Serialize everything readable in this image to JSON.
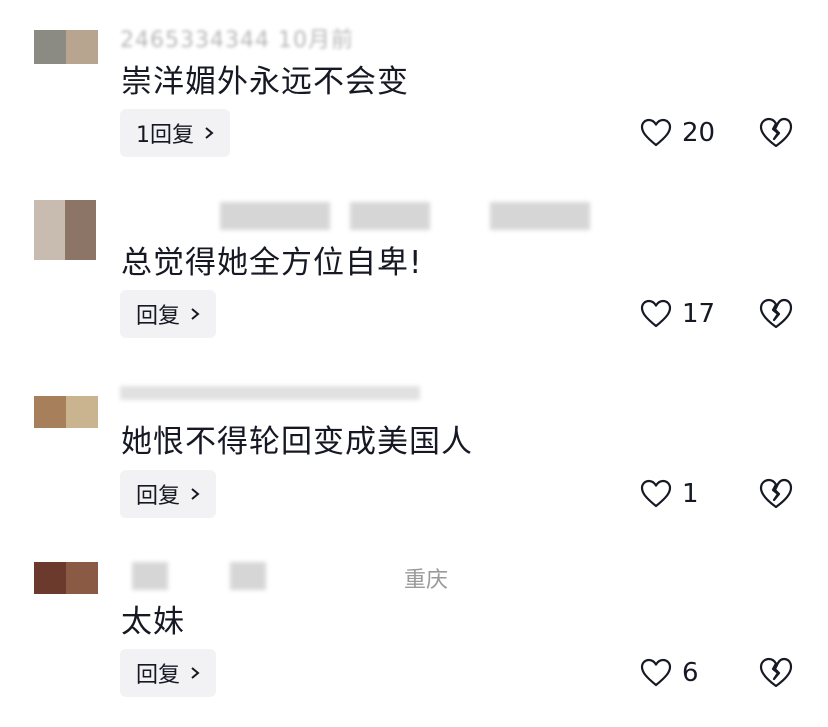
{
  "comments": [
    {
      "meta_partial": "2465334344 10月前",
      "text": "崇洋媚外永远不会变",
      "reply_label": "1回复",
      "likes": "20"
    },
    {
      "meta_partial": "",
      "text": "总觉得她全方位自卑!",
      "reply_label": "回复",
      "likes": "17"
    },
    {
      "meta_partial": "",
      "text": "她恨不得轮回变成美国人",
      "reply_label": "回复",
      "likes": "1"
    },
    {
      "meta_location": "重庆",
      "text": "太妹",
      "reply_label": "回复",
      "likes": "6"
    }
  ],
  "icons": {
    "like": "heart-outline-icon",
    "dislike": "broken-heart-icon",
    "reply_chevron": "chevron-right-icon"
  }
}
